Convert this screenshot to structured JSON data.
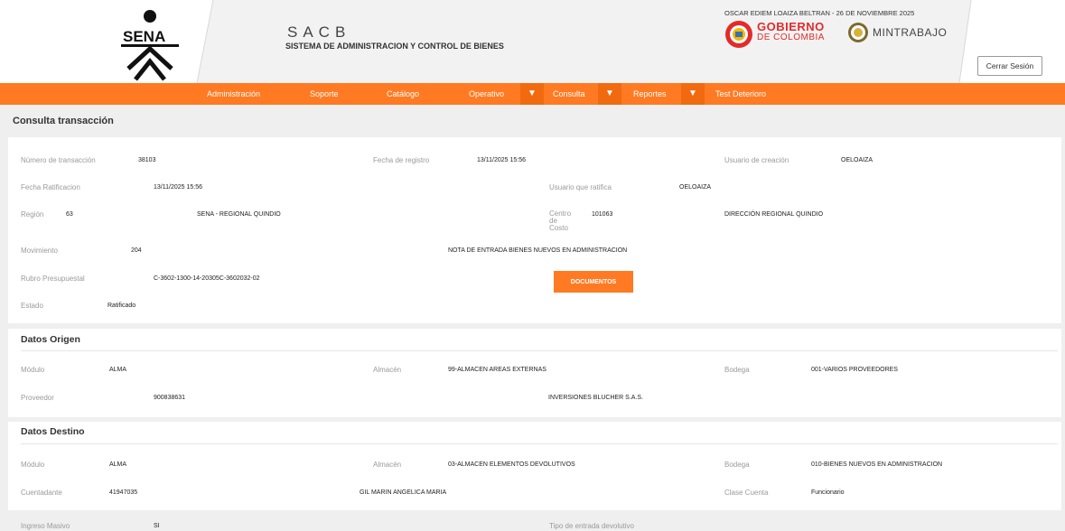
{
  "header": {
    "logo_text": "SENA",
    "app_name": "SACB",
    "app_subtitle": "SISTEMA DE ADMINISTRACION Y CONTROL DE BIENES",
    "user_info": "OSCAR EDIEM LOAIZA BELTRAN - 26 DE NOVIEMBRE 2025",
    "gob_line1": "GOBIERNO",
    "gob_line2": "DE COLOMBIA",
    "mintrabajo": "MINTRABAJO",
    "logout_label": "Cerrar Sesión"
  },
  "nav": {
    "items": [
      "Administración",
      "Soporte",
      "Catálogo",
      "Operativo",
      "Consulta",
      "Reportes",
      "Test Deterioro"
    ],
    "arrow": "▼"
  },
  "page_title": "Consulta transacción",
  "transaccion": {
    "numero_label": "Número de transacción",
    "numero": "38103",
    "fecha_registro_label": "Fecha de registro",
    "fecha_registro": "13/11/2025 15:56",
    "usuario_creacion_label": "Usuario de creación",
    "usuario_creacion": "OELOAIZA",
    "fecha_ratificacion_label": "Fecha Ratificacion",
    "fecha_ratificacion": "13/11/2025 15:56",
    "usuario_ratifica_label": "Usuario que ratifica",
    "usuario_ratifica": "OELOAIZA",
    "region_label": "Región",
    "region_code": "63",
    "region_name": "SENA - REGIONAL QUINDIO",
    "centro_costo_label1": "Centro",
    "centro_costo_label2": "de",
    "centro_costo_label3": "Costo",
    "centro_costo_code": "101063",
    "centro_costo_name": "DIRECCIÓN REGIONAL QUINDIO",
    "movimiento_label": "Movimiento",
    "movimiento_code": "204",
    "movimiento_name": "NOTA DE ENTRADA BIENES NUEVOS EN ADMINISTRACION",
    "rubro_label": "Rubro Presupuestal",
    "rubro": "C-3602-1300-14-20305C-3602032-02",
    "documentos_label": "DOCUMENTOS",
    "estado_label": "Estado",
    "estado": "Ratificado"
  },
  "origen": {
    "title": "Datos Origen",
    "modulo_label": "Módulo",
    "modulo": "ALMA",
    "almacen_label": "Almacén",
    "almacen": "99-ALMACEN AREAS EXTERNAS",
    "bodega_label": "Bodega",
    "bodega": "001-VARIOS PROVEEDORES",
    "proveedor_label": "Proveedor",
    "proveedor_nit": "900838631",
    "proveedor_name": "INVERSIONES BLUCHER S.A.S."
  },
  "destino": {
    "title": "Datos Destino",
    "modulo_label": "Módulo",
    "modulo": "ALMA",
    "almacen_label": "Almacén",
    "almacen": "03-ALMACEN ELEMENTOS DEVOLUTIVOS",
    "bodega_label": "Bodega",
    "bodega": "010-BIENES NUEVOS EN ADMINISTRACION",
    "cuentadante_label": "Cuentadante",
    "cuentadante_id": "41947035",
    "cuentadante_name": "GIL MARIN ANGELICA MARIA",
    "clase_cuenta_label": "Clase Cuenta",
    "clase_cuenta": "Funcionario"
  },
  "extra": {
    "ingreso_masivo_label": "Ingreso Masivo",
    "ingreso_masivo": "SI",
    "tipo_entrada_label": "Tipo de entrada devolutivo"
  },
  "colors": {
    "brand_orange": "#ff7a22",
    "nav_arrow_bg": "#f26a10",
    "gob_red": "#e32b2b"
  }
}
